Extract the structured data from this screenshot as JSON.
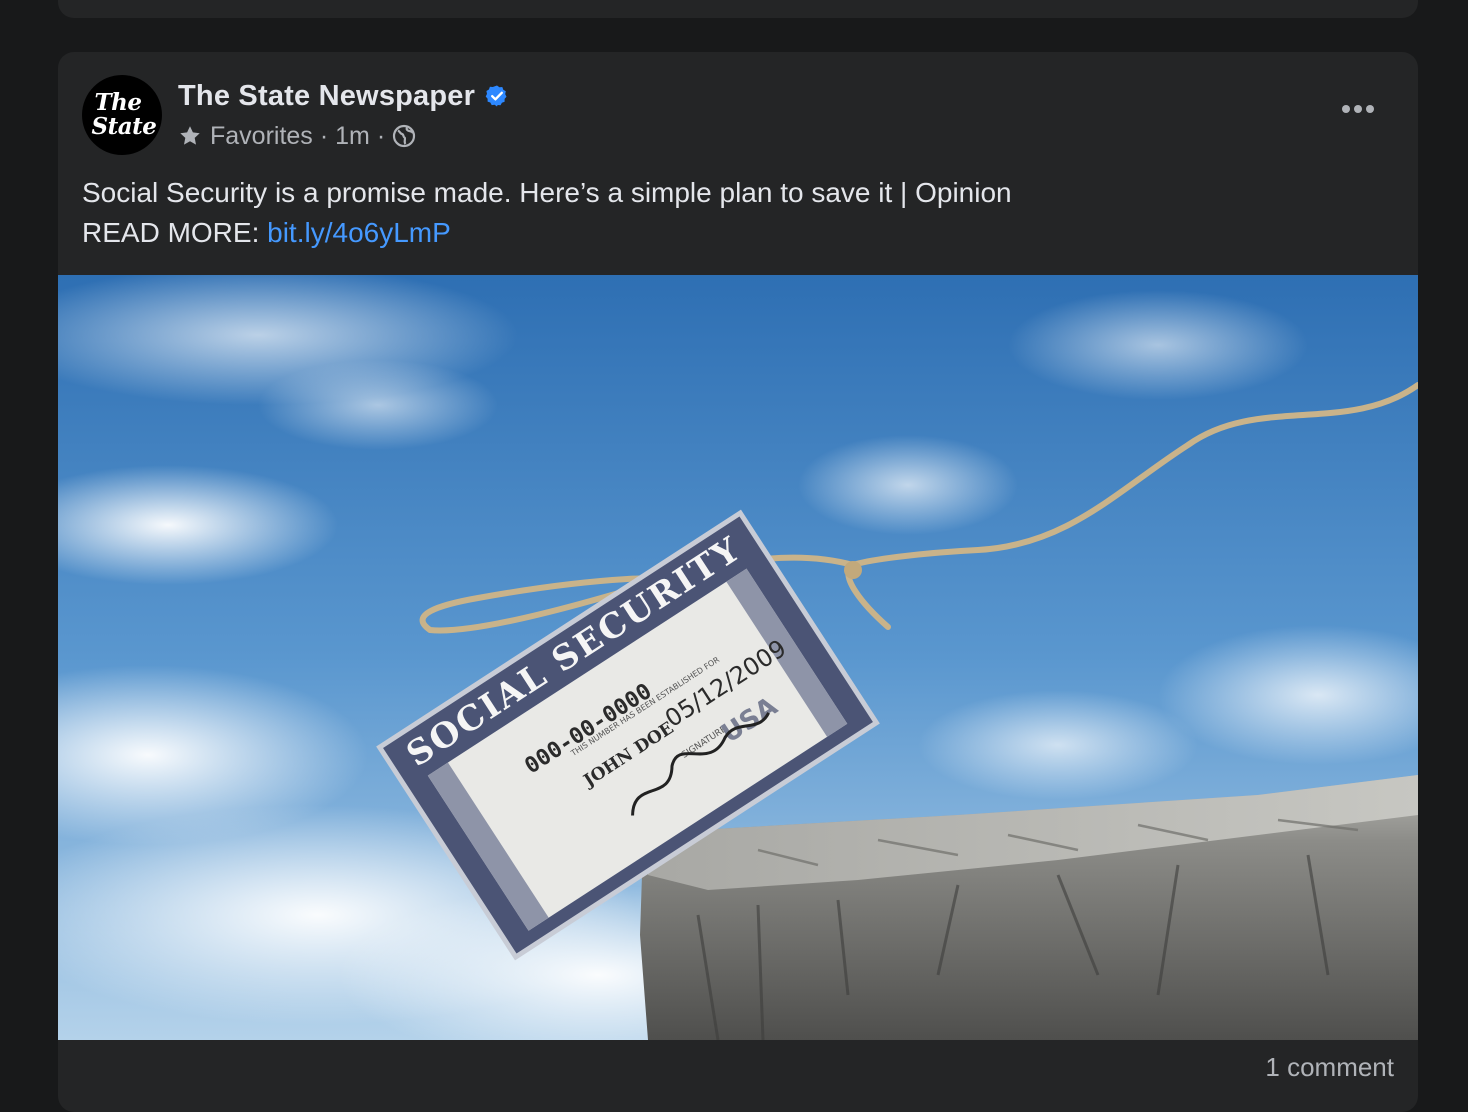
{
  "post": {
    "page_name": "The State Newspaper",
    "avatar_line1": "The",
    "avatar_line2": "State",
    "audience": "Favorites",
    "time": "1m",
    "separator": "·",
    "text_line1": "Social Security is a promise made. Here’s a simple plan to save it | Opinion",
    "read_more_label": "READ MORE: ",
    "link": "bit.ly/4o6yLmP",
    "comments": "1 comment",
    "icons": {
      "verified": "verified-badge-icon",
      "audience": "star-icon",
      "privacy": "globe-icon",
      "menu": "more-options-icon"
    },
    "image": {
      "card_title": "SOCIAL SECURITY",
      "card_number": "000-00-0000",
      "card_name": "JOHN DOE",
      "card_date": "05/12/2009",
      "card_fine_print": "THIS NUMBER HAS BEEN ESTABLISHED FOR",
      "card_signature_label": "SIGNATURE",
      "card_country": "USA"
    }
  },
  "colors": {
    "background": "#18191a",
    "card": "#242526",
    "primary_text": "#e4e6eb",
    "secondary_text": "#b0b3b8",
    "link": "#4599ff",
    "verified": "#2d88ff"
  }
}
